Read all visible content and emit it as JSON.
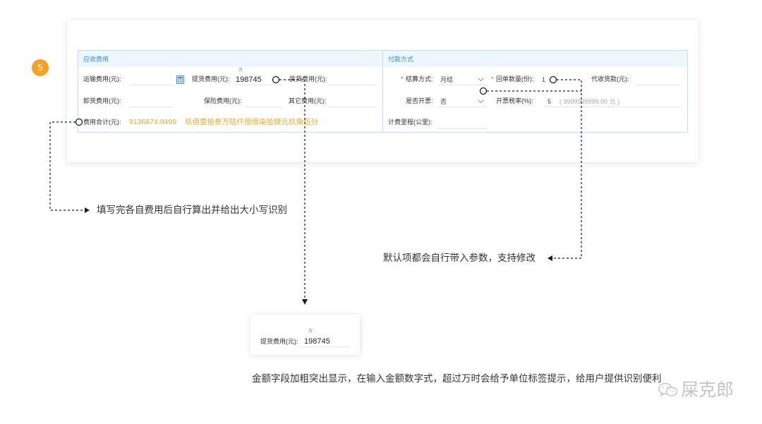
{
  "step_badge": "5",
  "receivable": {
    "title": "应收费用",
    "freight_label": "运输费用(元):",
    "pickup_label": "提货费用(元):",
    "pickup_unit_tag": "万",
    "pickup_value": "198745",
    "loading_label": "装货费用(元):",
    "unloading_label": "卸货费用(元):",
    "insurance_label": "保险费用(元):",
    "other_label": "其它费用(元):",
    "total_label": "费用合计(元):",
    "total_value": "9136874.9499",
    "total_uppercase": "玖佰壹拾叁万陆仟捌佰柒拾肆元玖角伍分"
  },
  "payment": {
    "title": "付款方式",
    "required_mark": "*",
    "settlement_label": "结算方式:",
    "settlement_value": "月结",
    "receipt_count_label": "回单数量(份):",
    "receipt_count_value": "1",
    "cod_label": "代收货款(元):",
    "invoice_label": "是否开票:",
    "invoice_value": "否",
    "tax_rate_label": "开票税率(%):",
    "tax_rate_value": "5",
    "tax_rate_hint": "( 9999999999.00 元 )",
    "mileage_label": "计费里程(公里):"
  },
  "annotations": {
    "total_note": "填写完各自费用后自行算出并给出大小写识别",
    "defaults_note": "默认项都会自行带入参数，支持修改",
    "amount_note": "金额字段加粗突出显示，在输入金额数字式，超过万时会给予单位标签提示，给用户提供识别便利"
  },
  "zoom_preview": {
    "unit_tag": "万",
    "label": "提货费用(元):",
    "value": "198745"
  },
  "watermark": "屎克郎",
  "icons": {
    "calculator": "calculator-icon",
    "select_arrow": "chevron-down-icon",
    "callout_marker": "circle-marker-icon",
    "watermark_logo": "wechat-icon"
  },
  "colors": {
    "badge": "#f5a128",
    "accent": "#3d8fd6",
    "total_orange": "#f5a623",
    "required": "#e8463a",
    "panel_border": "#bfe3f1",
    "header_bg": "#ecf7fc"
  }
}
